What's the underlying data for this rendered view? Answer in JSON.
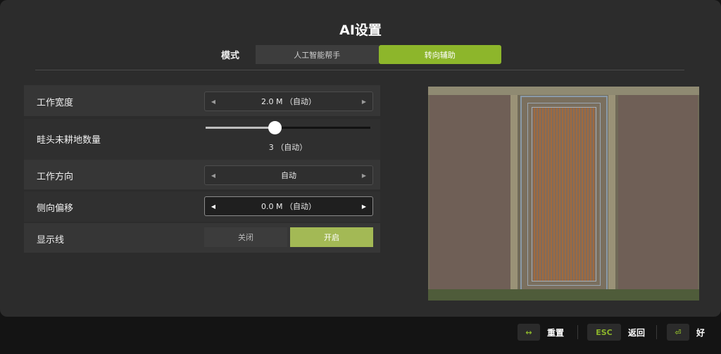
{
  "title": "AI设置",
  "mode": {
    "label": "模式",
    "tabs": [
      {
        "label": "人工智能帮手",
        "active": false
      },
      {
        "label": "转向辅助",
        "active": true
      }
    ]
  },
  "settings": {
    "work_width": {
      "label": "工作宽度",
      "value": "2.0 M （自动）"
    },
    "headland": {
      "label": "畦头未耕地数量",
      "value_text": "3 （自动）",
      "fraction": 0.42
    },
    "work_direction": {
      "label": "工作方向",
      "value": "自动"
    },
    "side_offset": {
      "label": "侧向偏移",
      "value": "0.0 M （自动）"
    },
    "show_lines": {
      "label": "显示线",
      "options": [
        "关闭",
        "开启"
      ],
      "selected": "开启"
    }
  },
  "footer": {
    "reset": {
      "key": "↔",
      "label": "重置"
    },
    "back": {
      "key": "ESC",
      "label": "返回"
    },
    "ok": {
      "key": "⏎",
      "label": "好"
    }
  },
  "colors": {
    "accent": "#8db62b",
    "toggle_on": "#a3b955"
  }
}
